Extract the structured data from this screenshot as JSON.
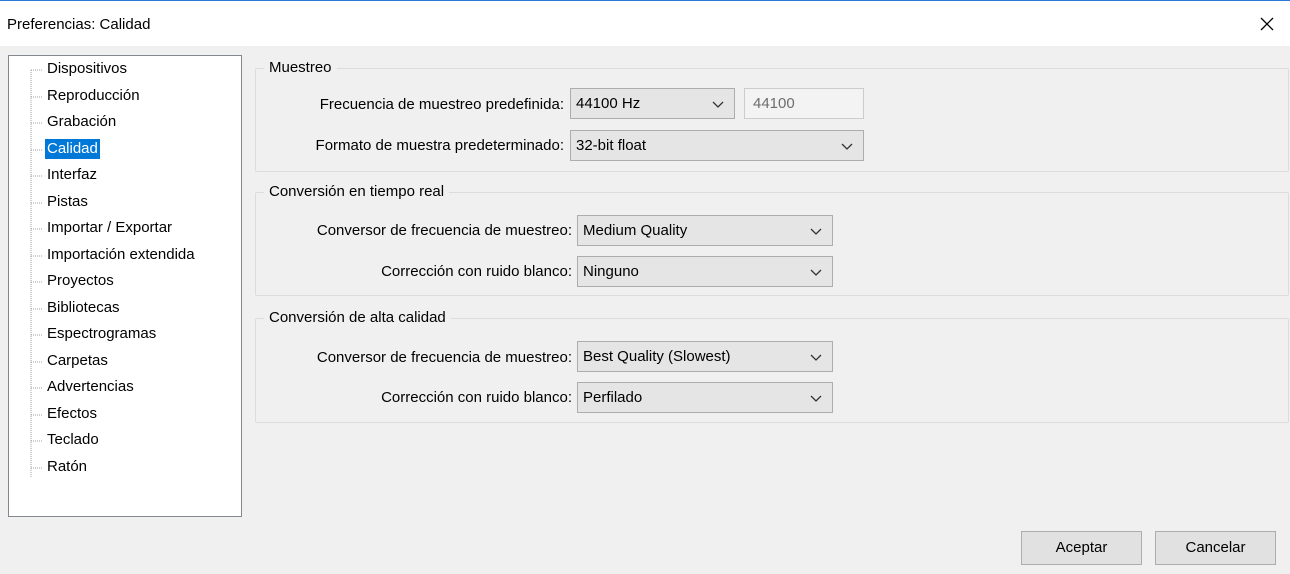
{
  "window": {
    "title": "Preferencias: Calidad"
  },
  "tree": {
    "items": [
      "Dispositivos",
      "Reproducción",
      "Grabación",
      "Calidad",
      "Interfaz",
      "Pistas",
      "Importar / Exportar",
      "Importación extendida",
      "Proyectos",
      "Bibliotecas",
      "Espectrogramas",
      "Carpetas",
      "Advertencias",
      "Efectos",
      "Teclado",
      "Ratón"
    ],
    "selected": "Calidad"
  },
  "muestreo": {
    "label": "Muestreo",
    "rate_label": "Frecuencia de muestreo predefinida:",
    "rate_value": "44100 Hz",
    "rate_text": "44100",
    "format_label": "Formato de muestra predeterminado:",
    "format_value": "32-bit float"
  },
  "realtime": {
    "label": "Conversión en tiempo real",
    "converter_label": "Conversor de frecuencia de muestreo:",
    "converter_value": "Medium Quality",
    "dither_label": "Corrección con ruido blanco:",
    "dither_value": "Ninguno"
  },
  "highquality": {
    "label": "Conversión de alta calidad",
    "converter_label": "Conversor de frecuencia de muestreo:",
    "converter_value": "Best Quality (Slowest)",
    "dither_label": "Corrección con ruido blanco:",
    "dither_value": "Perfilado"
  },
  "buttons": {
    "ok": "Aceptar",
    "cancel": "Cancelar"
  },
  "icons": {
    "close": "close-icon",
    "dropdown": "chevron-down-icon"
  },
  "colors": {
    "selection": "#0078d7",
    "title_border": "#2b79d6"
  }
}
